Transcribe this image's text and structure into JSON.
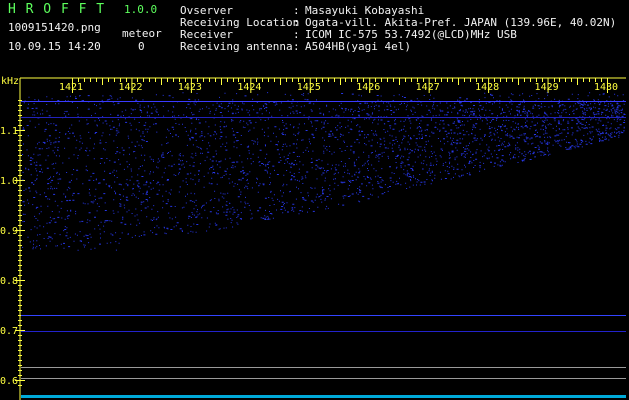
{
  "app": {
    "name": "H R O F F T",
    "version": "1.0.0"
  },
  "file": {
    "filename": "1009151420.png",
    "datetime": "10.09.15 14:20"
  },
  "meteor": {
    "label": "meteor",
    "count": "0"
  },
  "station": [
    {
      "label": "Ovserver",
      "sep": ":",
      "value": "Masayuki Kobayashi"
    },
    {
      "label": "Receiving Location",
      "sep": ":",
      "value": "Ogata-vill. Akita-Pref. JAPAN (139.96E, 40.02N)"
    },
    {
      "label": "Receiver",
      "sep": ":",
      "value": "ICOM IC-575 53.7492(@LCD)MHz USB"
    },
    {
      "label": "Receiving antenna",
      "sep": ":",
      "value": "A504HB(yagi 4el)"
    }
  ],
  "axis": {
    "unit": "kHz",
    "y_ticks": [
      "1.1",
      "1.0",
      "0.9",
      "0.8",
      "0.7",
      "0.6"
    ],
    "x_ticks": [
      "1421",
      "1422",
      "1423",
      "1424",
      "1425",
      "1426",
      "1427",
      "1428",
      "1429",
      "1430"
    ]
  },
  "colors": {
    "title": "#5dff5d",
    "ticks": "#ffff40",
    "text": "#f2f2f2",
    "signal": "#2a3cff",
    "noise_floor": "#00c8ff"
  }
}
